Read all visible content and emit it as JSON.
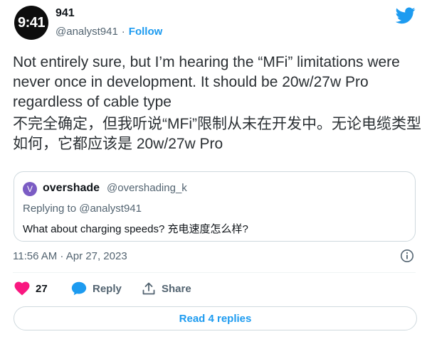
{
  "tweet": {
    "avatar_text": "9:41",
    "author_name": "941",
    "handle": "@analyst941",
    "separator": "·",
    "follow_label": "Follow",
    "text_en": "Not entirely sure, but I’m hearing the “MFi” limitations were never once in development. It should be 20w/27w Pro regardless of cable type",
    "text_cn": "不完全确定，但我听说“MFi”限制从未在开发中。无论电缆类型如何，它都应该是 20w/27w Pro",
    "timestamp": "11:56 AM · Apr 27, 2023"
  },
  "quote": {
    "avatar_letter": "V",
    "name": "overshade",
    "handle": "@overshading_k",
    "replying_to": "Replying to @analyst941",
    "text": "What about charging speeds? 充电速度怎么样?"
  },
  "actions": {
    "like_count": "27",
    "reply_label": "Reply",
    "share_label": "Share"
  },
  "read_replies_label": "Read 4 replies",
  "colors": {
    "accent": "#1d9bf0",
    "like": "#f91880",
    "muted": "#536471",
    "text": "#0f1419"
  },
  "icons": [
    "twitter-bird-icon",
    "info-icon",
    "heart-icon",
    "reply-bubble-icon",
    "share-icon"
  ]
}
